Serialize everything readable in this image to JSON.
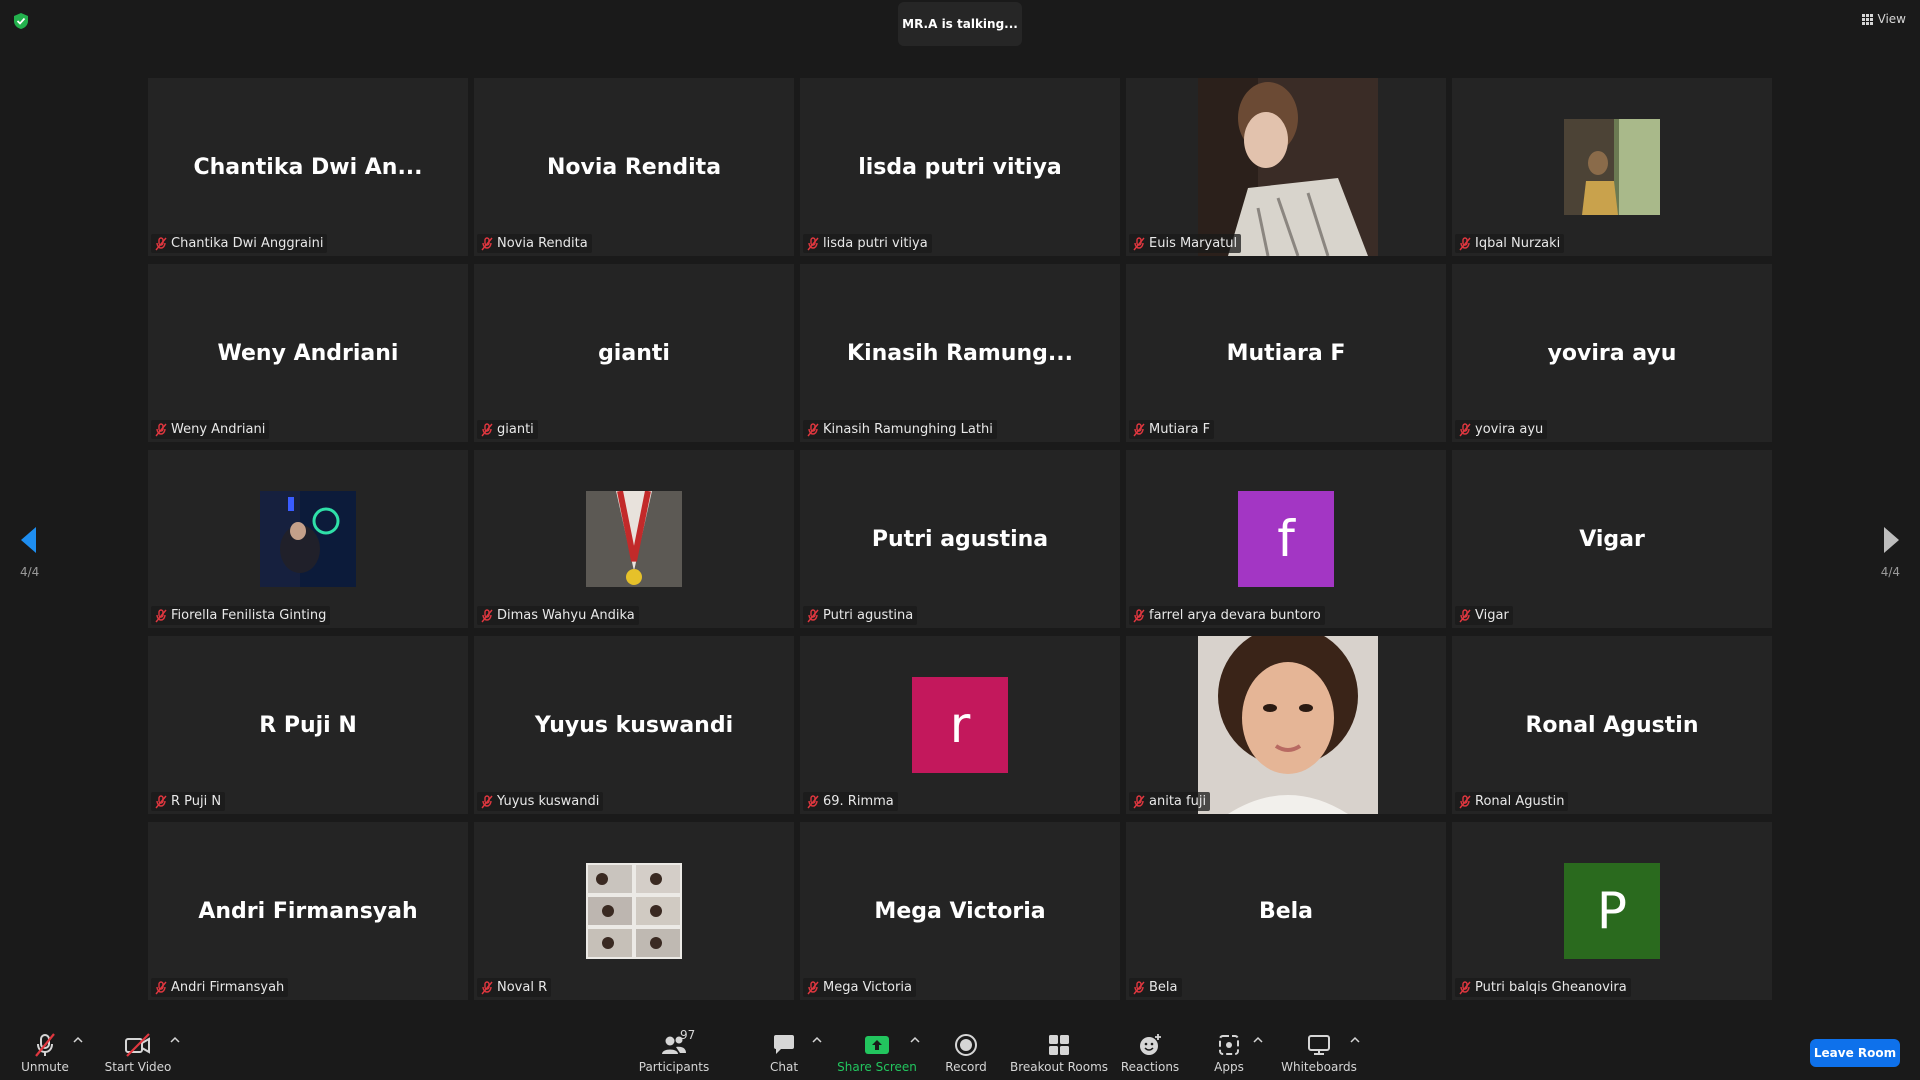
{
  "header": {
    "talking_indicator": "MR.A is talking...",
    "view_label": "View"
  },
  "pagination": {
    "left": "4/4",
    "right": "4/4"
  },
  "participants": [
    {
      "display": "Chantika  Dwi  An...",
      "label": "Chantika Dwi Anggraini",
      "kind": "name"
    },
    {
      "display": "Novia Rendita",
      "label": "Novia Rendita",
      "kind": "name"
    },
    {
      "display": "lisda putri vitiya",
      "label": "lisda putri vitiya",
      "kind": "name"
    },
    {
      "display": "",
      "label": "Euis Maryatul",
      "kind": "photo"
    },
    {
      "display": "",
      "label": "Iqbal Nurzaki",
      "kind": "smallphoto"
    },
    {
      "display": "Weny Andriani",
      "label": "Weny Andriani",
      "kind": "name"
    },
    {
      "display": "gianti",
      "label": "gianti",
      "kind": "name"
    },
    {
      "display": "Kinasih  Ramung...",
      "label": "Kinasih Ramunghing Lathi",
      "kind": "name"
    },
    {
      "display": "Mutiara F",
      "label": "Mutiara F",
      "kind": "name"
    },
    {
      "display": "yovira ayu",
      "label": "yovira ayu",
      "kind": "name"
    },
    {
      "display": "",
      "label": "Fiorella Fenilista Ginting",
      "kind": "smallphoto"
    },
    {
      "display": "",
      "label": "Dimas Wahyu Andika",
      "kind": "smallphoto"
    },
    {
      "display": "Putri agustina",
      "label": "Putri agustina",
      "kind": "name"
    },
    {
      "display": "f",
      "label": "farrel arya devara buntoro",
      "kind": "avatar",
      "color": "#a336c4"
    },
    {
      "display": "Vigar",
      "label": "Vigar",
      "kind": "name"
    },
    {
      "display": "R Puji N",
      "label": "R Puji N",
      "kind": "name"
    },
    {
      "display": "Yuyus kuswandi",
      "label": "Yuyus kuswandi",
      "kind": "name"
    },
    {
      "display": "r",
      "label": "69. Rimma",
      "kind": "avatar",
      "color": "#c3185c"
    },
    {
      "display": "",
      "label": "anita fuji",
      "kind": "photo"
    },
    {
      "display": "Ronal Agustin",
      "label": "Ronal Agustin",
      "kind": "name"
    },
    {
      "display": "Andri Firmansyah",
      "label": "Andri Firmansyah",
      "kind": "name"
    },
    {
      "display": "",
      "label": "Noval R",
      "kind": "smallphoto"
    },
    {
      "display": "Mega Victoria",
      "label": "Mega Victoria",
      "kind": "name"
    },
    {
      "display": "Bela",
      "label": "Bela",
      "kind": "name"
    },
    {
      "display": "P",
      "label": "Putri balqis Gheanovira",
      "kind": "avatar",
      "color": "#2a6a1e"
    }
  ],
  "toolbar": {
    "unmute": "Unmute",
    "start_video": "Start Video",
    "participants": "Participants",
    "participants_count": "97",
    "chat": "Chat",
    "share_screen": "Share Screen",
    "record": "Record",
    "breakout_rooms": "Breakout Rooms",
    "reactions": "Reactions",
    "apps": "Apps",
    "whiteboards": "Whiteboards",
    "leave": "Leave Room"
  },
  "colors": {
    "accent": "#0e71eb",
    "share": "#22c55e",
    "mute_red": "#e0373f"
  }
}
